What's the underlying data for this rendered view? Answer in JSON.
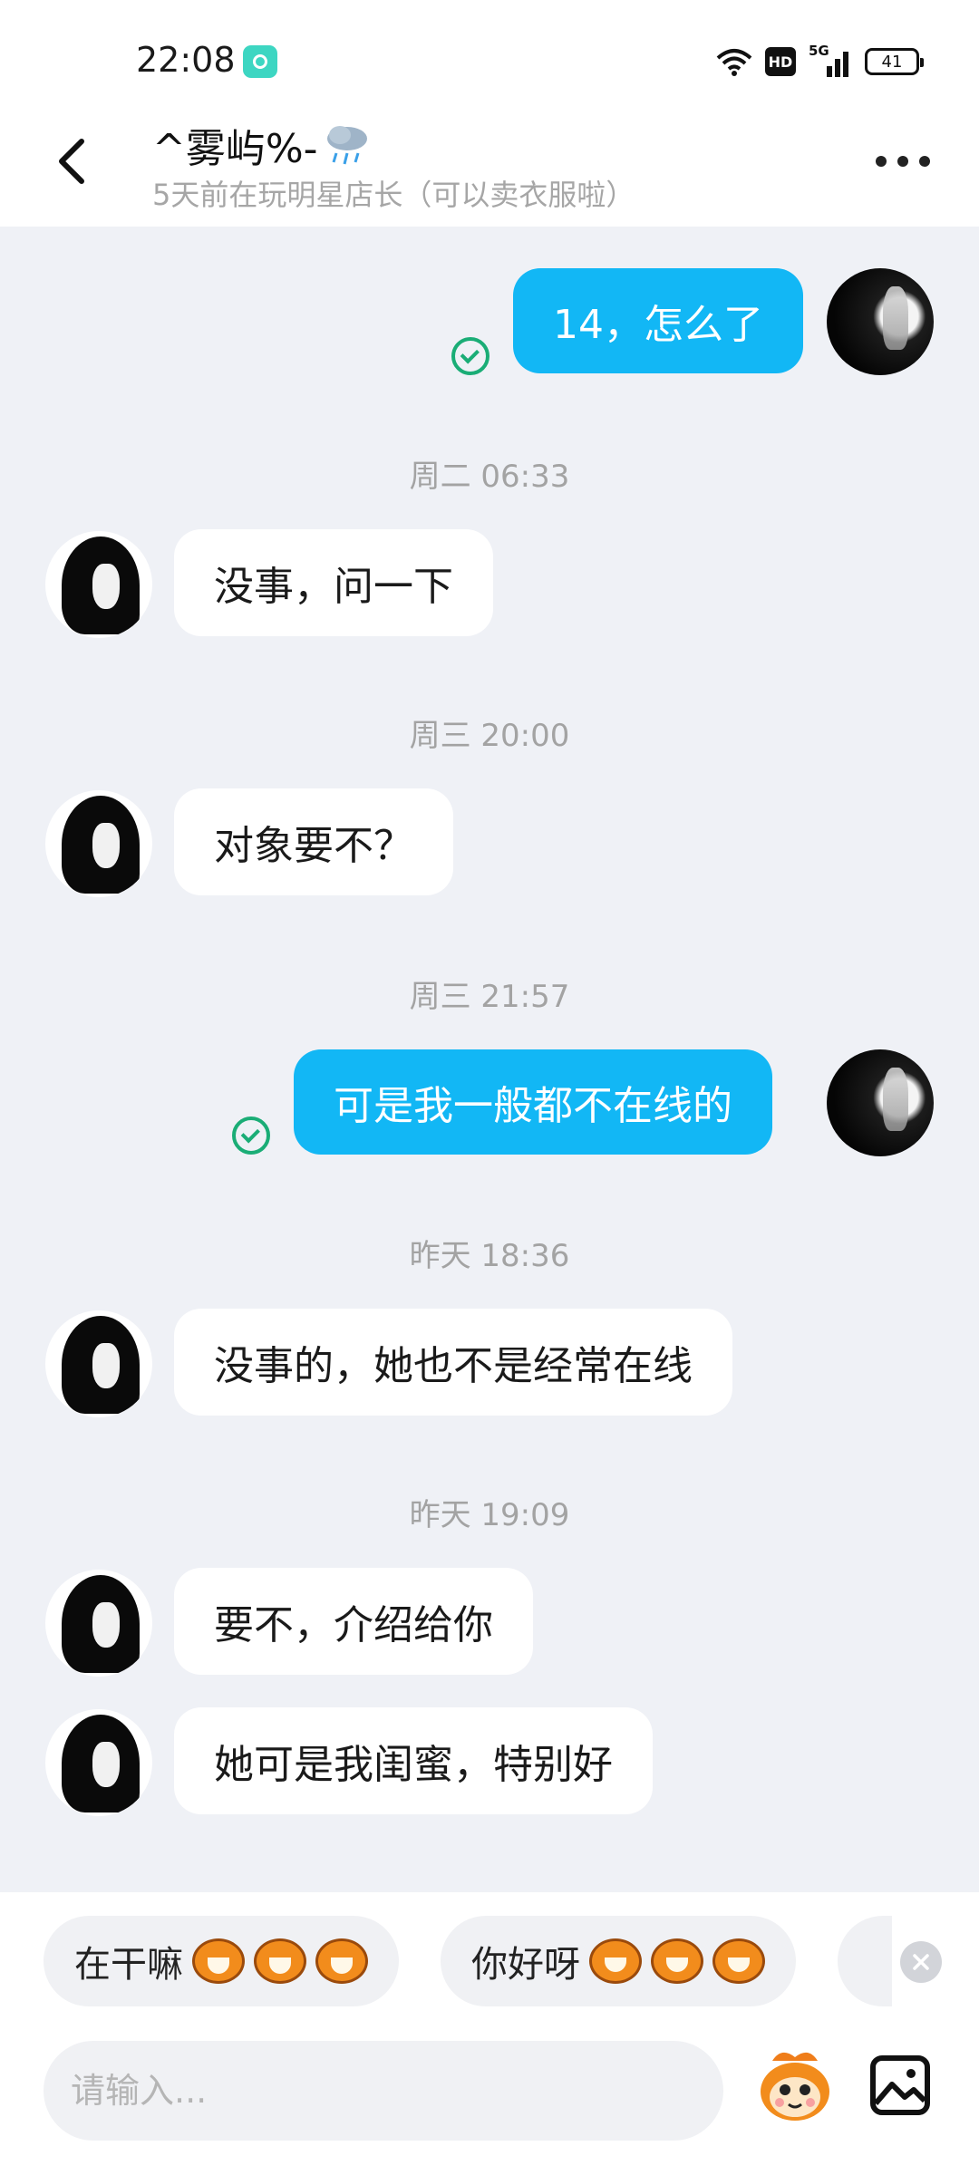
{
  "status_bar": {
    "time": "22:08",
    "hd": "HD",
    "network": "5G",
    "battery": "41"
  },
  "header": {
    "title": "^雾屿%-",
    "title_icon": "rain-cloud-icon",
    "subtitle": "5天前在玩明星店长（可以卖衣服啦）"
  },
  "messages": [
    {
      "sender": "me",
      "text": "14，怎么了",
      "read": true
    },
    {
      "type": "time",
      "text": "周二 06:33"
    },
    {
      "sender": "her",
      "text": "没事，问一下"
    },
    {
      "type": "time",
      "text": "周三 20:00"
    },
    {
      "sender": "her",
      "text": "对象要不？"
    },
    {
      "type": "time",
      "text": "周三 21:57"
    },
    {
      "sender": "me",
      "text": "可是我一般都不在线的",
      "read": true
    },
    {
      "type": "time",
      "text": "昨天 18:36"
    },
    {
      "sender": "her",
      "text": "没事的，她也不是经常在线"
    },
    {
      "type": "time",
      "text": "昨天 19:09"
    },
    {
      "sender": "her",
      "text": "要不，介绍给你"
    },
    {
      "sender": "her",
      "text": "她可是我闺蜜，特别好"
    }
  ],
  "quick_replies": [
    {
      "text": "在干嘛",
      "emoji": "laughing-monkey-icon"
    },
    {
      "text": "你好呀",
      "emoji": "big-eyed-monkey-icon"
    }
  ],
  "input": {
    "placeholder": "请输入..."
  },
  "colors": {
    "my_bubble": "#12b7f5",
    "chat_background": "#eff1f6",
    "read_check": "#1aad76"
  }
}
